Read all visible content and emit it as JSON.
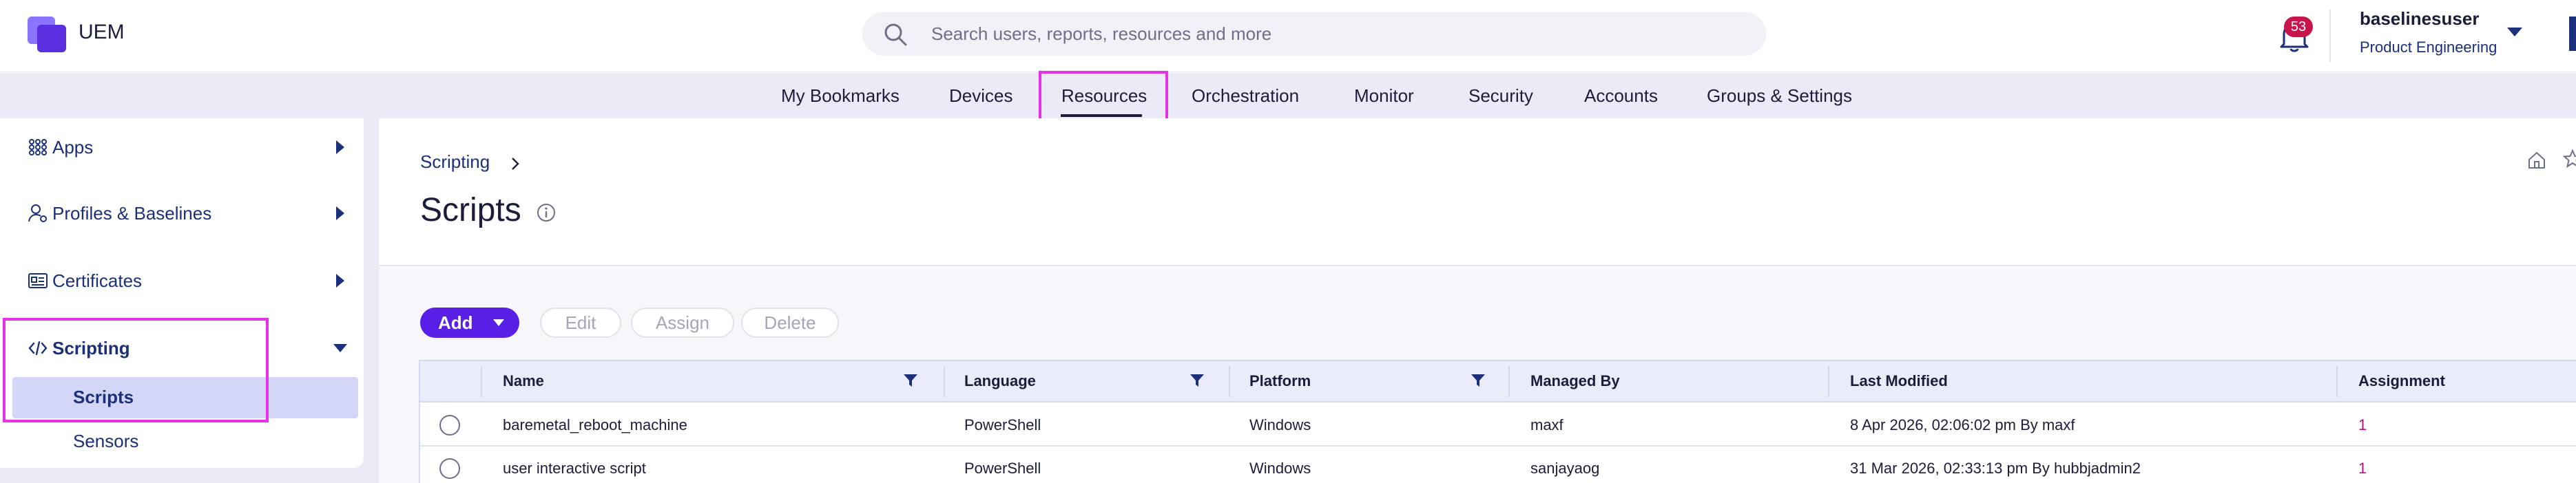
{
  "app": {
    "name": "UEM"
  },
  "search": {
    "placeholder": "Search users, reports, resources and more"
  },
  "notifications": {
    "count": "53"
  },
  "user": {
    "name": "baselinesuser",
    "org": "Product Engineering"
  },
  "topnav": {
    "items": [
      "My Bookmarks",
      "Devices",
      "Resources",
      "Orchestration",
      "Monitor",
      "Security",
      "Accounts",
      "Groups & Settings"
    ],
    "active": "Resources"
  },
  "sidebar": {
    "items": [
      {
        "label": "Apps",
        "icon": "grid-icon"
      },
      {
        "label": "Profiles & Baselines",
        "icon": "user-settings-icon"
      },
      {
        "label": "Certificates",
        "icon": "certificate-icon"
      },
      {
        "label": "Scripting",
        "icon": "code-icon",
        "expanded": true
      }
    ],
    "subitems": [
      {
        "label": "Scripts",
        "active": true
      },
      {
        "label": "Sensors"
      }
    ]
  },
  "page": {
    "breadcrumb": "Scripting",
    "title": "Scripts"
  },
  "toolbar": {
    "add": "Add",
    "edit": "Edit",
    "assign": "Assign",
    "delete": "Delete"
  },
  "table": {
    "columns": [
      "Name",
      "Language",
      "Platform",
      "Managed By",
      "Last Modified",
      "Assignment"
    ],
    "rows": [
      {
        "name": "baremetal_reboot_machine",
        "language": "PowerShell",
        "platform": "Windows",
        "managed_by": "maxf",
        "last_modified": "8 Apr 2026, 02:06:02 pm By maxf",
        "assignment": "1"
      },
      {
        "name": "user interactive script",
        "language": "PowerShell",
        "platform": "Windows",
        "managed_by": "sanjayaog",
        "last_modified": "31 Mar 2026, 02:33:13 pm By hubbjadmin2",
        "assignment": "1"
      }
    ]
  },
  "colors": {
    "accent": "#5a1fe6",
    "highlight": "#e632e6",
    "badge": "#c8154b",
    "link": "#b3127f"
  }
}
